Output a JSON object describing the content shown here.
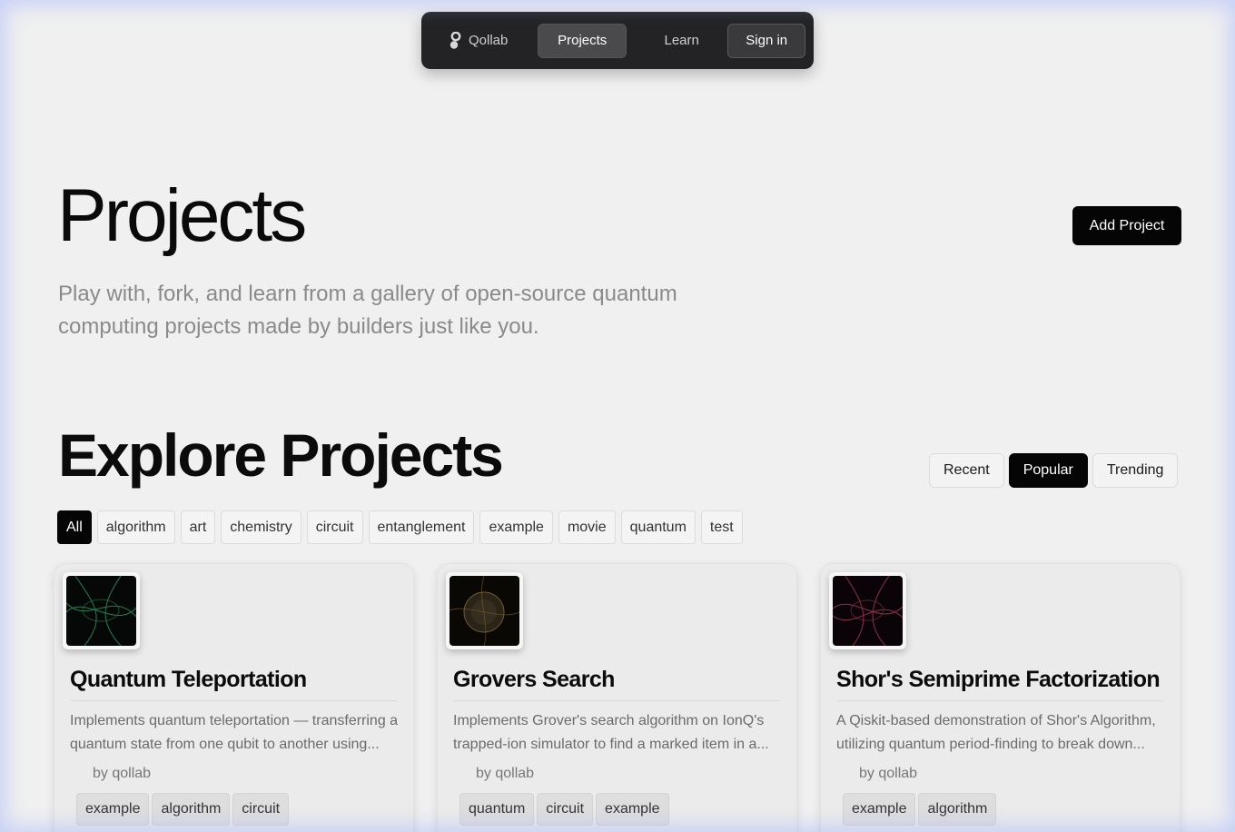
{
  "nav": {
    "brand": "Qollab",
    "items": [
      {
        "label": "Projects",
        "active": true
      },
      {
        "label": "Learn",
        "active": false
      }
    ],
    "signin_label": "Sign in"
  },
  "hero": {
    "title": "Projects",
    "subtitle": "Play with, fork, and learn from a gallery of open-source quantum computing projects made by builders just like you.",
    "add_button": "Add Project"
  },
  "explore": {
    "title": "Explore Projects",
    "sort_options": [
      "Recent",
      "Popular",
      "Trending"
    ],
    "sort_selected": "Popular",
    "tags": [
      "All",
      "algorithm",
      "art",
      "chemistry",
      "circuit",
      "entanglement",
      "example",
      "movie",
      "quantum",
      "test"
    ],
    "tag_selected": "All"
  },
  "projects": [
    {
      "title": "Quantum Teleportation",
      "description": "Implements quantum teleportation — transferring a quantum state from one qubit to another using...",
      "author": "by qollab",
      "tags": [
        "example",
        "algorithm",
        "circuit"
      ],
      "thumb_color": "#2a8a5a"
    },
    {
      "title": "Grovers Search",
      "description": "Implements Grover's search algorithm on IonQ's trapped-ion simulator to find a marked item in a...",
      "author": "by qollab",
      "tags": [
        "quantum",
        "circuit",
        "example"
      ],
      "thumb_color": "#8a6a2a"
    },
    {
      "title": "Shor's Semiprime Factorization",
      "description": "A Qiskit-based demonstration of Shor's Algorithm, utilizing quantum period-finding to break down...",
      "author": "by qollab",
      "tags": [
        "example",
        "algorithm"
      ],
      "thumb_color": "#9a2a4a"
    }
  ]
}
